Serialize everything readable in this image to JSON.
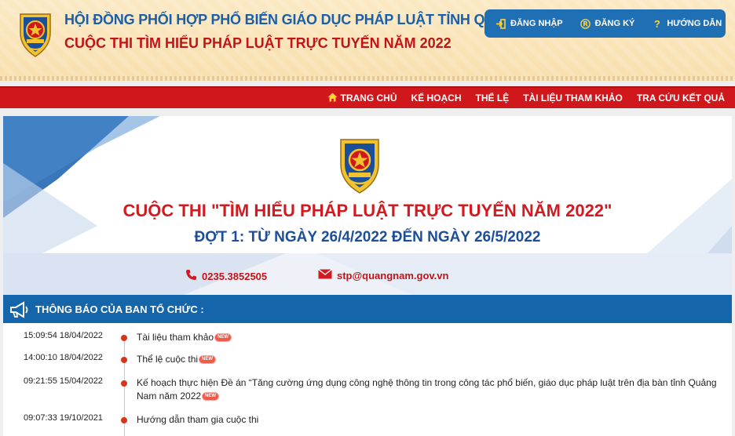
{
  "header": {
    "title_line1": "HỘI ĐỒNG PHỐI HỢP PHỔ BIẾN GIÁO DỤC PHÁP LUẬT TỈNH QUẢNG NAM",
    "title_line2": "CUỘC THI TÌM HIỂU PHÁP LUẬT TRỰC TUYẾN NĂM 2022",
    "auth": [
      {
        "label": "ĐĂNG NHẬP",
        "icon": "login-icon"
      },
      {
        "label": "ĐĂNG KÝ",
        "icon": "register-icon"
      },
      {
        "label": "HƯỚNG DẪN",
        "icon": "help-icon"
      }
    ]
  },
  "nav": {
    "items": [
      "TRANG CHỦ",
      "KẾ HOẠCH",
      "THỂ LỆ",
      "TÀI LIỆU THAM KHẢO",
      "TRA CỨU KẾT QUẢ"
    ]
  },
  "banner": {
    "title": "CUỘC THI \"TÌM HIỂU PHÁP LUẬT TRỰC TUYẾN NĂM 2022\"",
    "subtitle": "ĐỢT 1: TỪ NGÀY 26/4/2022 ĐẾN NGÀY 26/5/2022",
    "phone": "0235.3852505",
    "email": "stp@quangnam.gov.vn"
  },
  "notices": {
    "title": "THÔNG BÁO CỦA BAN TỔ CHỨC :",
    "new_badge": "NEW",
    "items": [
      {
        "time": "15:09:54 18/04/2022",
        "text": "Tài liệu tham khảo",
        "is_new": true
      },
      {
        "time": "14:00:10 18/04/2022",
        "text": "Thể lệ cuộc thi",
        "is_new": true
      },
      {
        "time": "09:21:55 15/04/2022",
        "text": "Kế hoạch thực hiện Đề án “Tăng cường ứng dụng công nghệ thông tin trong công tác phổ biến, giáo dục pháp luật trên địa bàn tỉnh Quảng Nam năm 2022",
        "is_new": true
      },
      {
        "time": "09:07:33 19/10/2021",
        "text": "Hướng dẫn tham gia cuộc thi",
        "is_new": false
      }
    ]
  },
  "colors": {
    "blue": "#1465a9",
    "red": "#d0171c",
    "title_blue": "#1a5fa8",
    "title_red": "#c01418"
  }
}
